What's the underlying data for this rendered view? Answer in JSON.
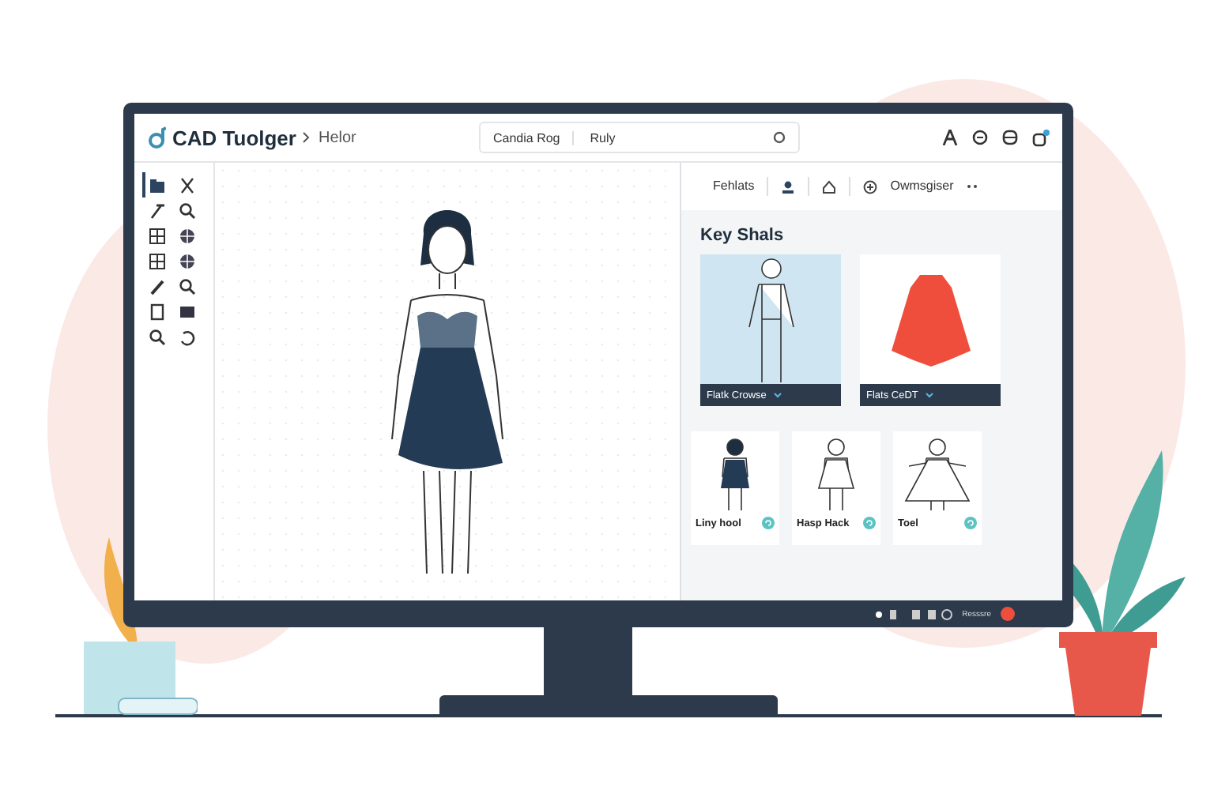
{
  "app": {
    "logo": "CAD Tuolger",
    "breadcrumb": "Helor",
    "search": {
      "tag": "Candia Rog",
      "value": "Ruly"
    }
  },
  "tools": [
    {
      "selected": true
    },
    {
      "selected": false
    },
    {
      "selected": false
    },
    {
      "selected": false
    },
    {
      "selected": false
    },
    {
      "selected": false
    },
    {
      "selected": false
    },
    {
      "selected": false
    },
    {
      "selected": false
    },
    {
      "selected": false
    },
    {
      "selected": false
    },
    {
      "selected": false
    },
    {
      "selected": false
    },
    {
      "selected": false
    }
  ],
  "panel": {
    "tabs": [
      {
        "label": "Fehlats",
        "selected": false
      },
      {
        "label": "Owmsgiser",
        "selected": false
      }
    ],
    "heading": "Key Shals",
    "cards": [
      {
        "label": "Flatk Crowse",
        "selected": true,
        "kind": "figure"
      },
      {
        "label": "Flats CeDT",
        "selected": false,
        "kind": "garment"
      }
    ],
    "thumbs": [
      {
        "label": "Liny hool",
        "kind": "dark"
      },
      {
        "label": "Hasp Hack",
        "kind": "outline"
      },
      {
        "label": "Toel",
        "kind": "gown"
      }
    ]
  },
  "status": {
    "text": "Resssre"
  }
}
